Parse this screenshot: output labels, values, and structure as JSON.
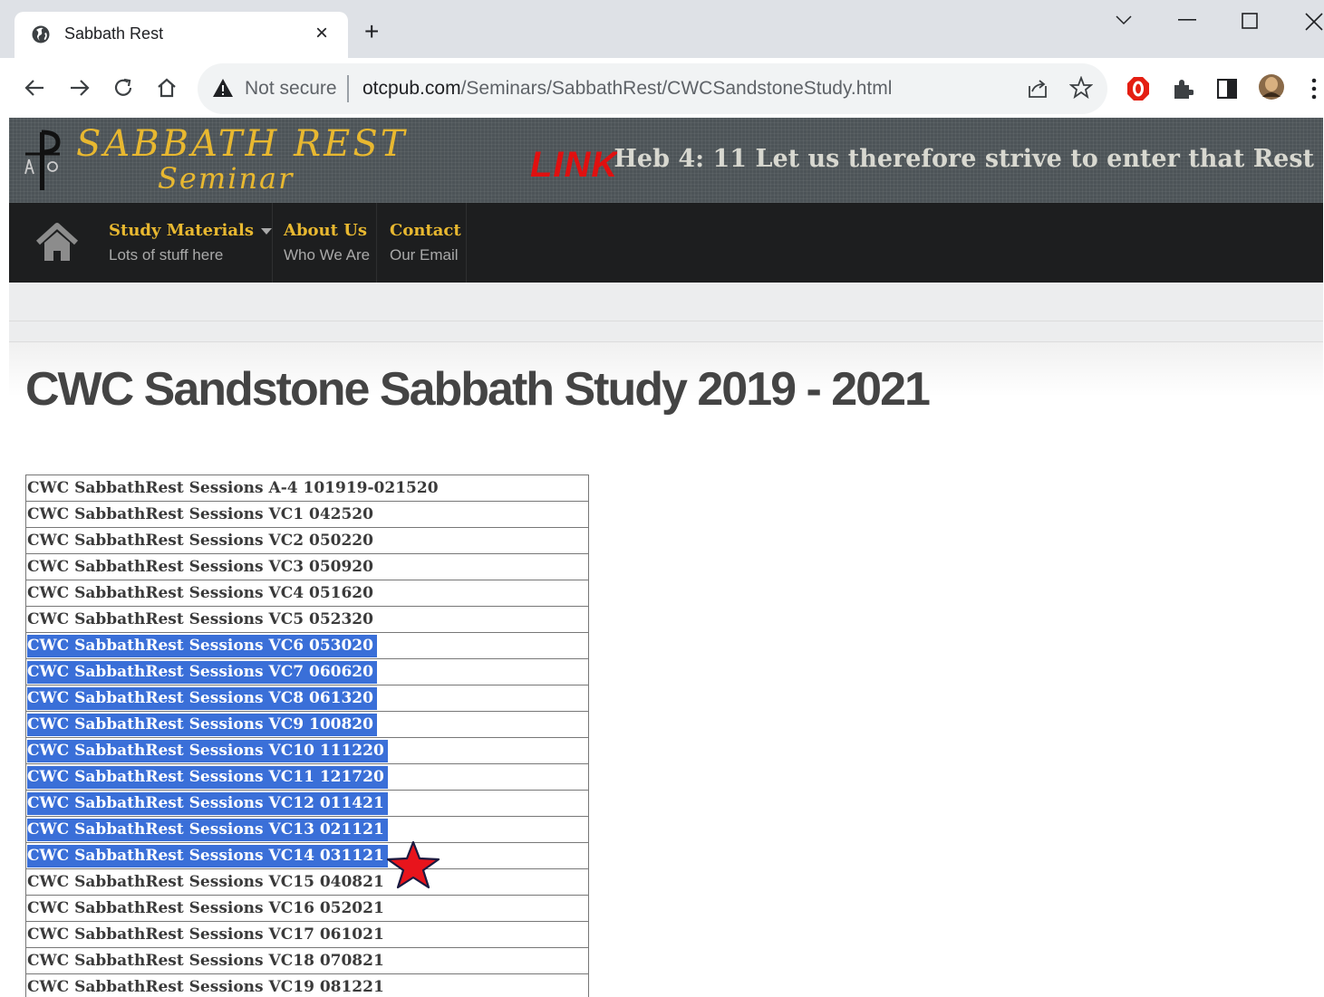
{
  "browser": {
    "tab_title": "Sabbath Rest",
    "tab_close": "×",
    "new_tab": "+",
    "not_secure": "Not secure",
    "url_host": "otcpub.com",
    "url_path": "/Seminars/SabbathRest/CWCSandstoneStudy.html"
  },
  "site": {
    "logo_line1": "SABBATH REST",
    "logo_line2": "Seminar",
    "link_label": "LINK",
    "verse": "Heb 4: 11 Let us therefore strive to enter that Rest",
    "menu": [
      {
        "title": "Study Materials",
        "subtitle": "Lots of stuff here"
      },
      {
        "title": "About Us",
        "subtitle": "Who We Are"
      },
      {
        "title": "Contact",
        "subtitle": "Our Email"
      }
    ],
    "page_title": "CWC Sandstone Sabbath Study 2019 - 2021"
  },
  "sessions": [
    {
      "label": "CWC SabbathRest Sessions A-4 101919-021520",
      "selected": false
    },
    {
      "label": "CWC SabbathRest Sessions VC1 042520",
      "selected": false
    },
    {
      "label": "CWC SabbathRest Sessions VC2 050220",
      "selected": false
    },
    {
      "label": "CWC SabbathRest Sessions VC3 050920",
      "selected": false
    },
    {
      "label": "CWC SabbathRest Sessions VC4 051620",
      "selected": false
    },
    {
      "label": "CWC SabbathRest Sessions VC5 052320",
      "selected": false
    },
    {
      "label": "CWC SabbathRest Sessions VC6 053020",
      "selected": true
    },
    {
      "label": "CWC SabbathRest Sessions VC7 060620",
      "selected": true
    },
    {
      "label": "CWC SabbathRest Sessions VC8 061320",
      "selected": true
    },
    {
      "label": "CWC SabbathRest Sessions VC9 100820",
      "selected": true
    },
    {
      "label": "CWC SabbathRest Sessions VC10 111220",
      "selected": true
    },
    {
      "label": "CWC SabbathRest Sessions VC11 121720",
      "selected": true
    },
    {
      "label": "CWC SabbathRest Sessions VC12 011421",
      "selected": true
    },
    {
      "label": "CWC SabbathRest Sessions VC13 021121",
      "selected": true
    },
    {
      "label": "CWC SabbathRest Sessions VC14 031121",
      "selected": true
    },
    {
      "label": "CWC SabbathRest Sessions VC15 040821",
      "selected": false
    },
    {
      "label": "CWC SabbathRest Sessions VC16 052021",
      "selected": false
    },
    {
      "label": "CWC SabbathRest Sessions VC17 061021",
      "selected": false
    },
    {
      "label": "CWC SabbathRest Sessions VC18 070821",
      "selected": false
    },
    {
      "label": "CWC SabbathRest Sessions VC19 081221",
      "selected": false
    }
  ],
  "colors": {
    "accent_gold": "#e8b830",
    "selection_blue": "#3a6fd8",
    "link_red": "#e01010",
    "star_red": "#e8141c"
  },
  "icons": [
    "globe-icon",
    "close-icon",
    "chevron-down-icon",
    "minimize-icon",
    "maximize-icon",
    "window-close-icon",
    "back-icon",
    "forward-icon",
    "reload-icon",
    "home-icon",
    "warning-icon",
    "share-icon",
    "bookmark-star-icon",
    "adblock-icon",
    "extensions-icon",
    "side-panel-icon",
    "profile-avatar-icon",
    "more-menu-icon",
    "site-home-icon",
    "red-star-icon"
  ]
}
